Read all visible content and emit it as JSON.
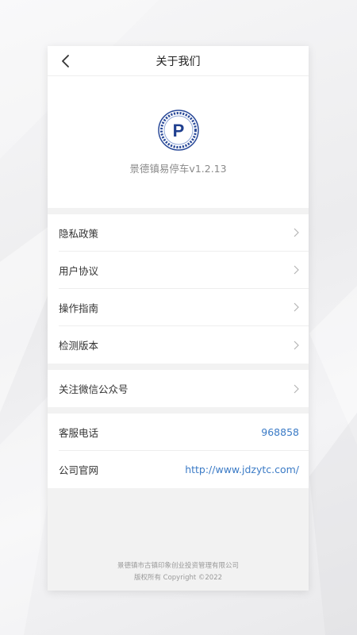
{
  "navbar": {
    "title": "关于我们"
  },
  "header": {
    "app_name": "景德镇易停车v1.2.13",
    "logo_letter": "P",
    "logo_color": "#1f3f8f"
  },
  "menu_group_1": [
    {
      "label": "隐私政策"
    },
    {
      "label": "用户协议"
    },
    {
      "label": "操作指南"
    },
    {
      "label": "检测版本"
    }
  ],
  "menu_group_2": [
    {
      "label": "关注微信公众号"
    }
  ],
  "contact_group": [
    {
      "label": "客服电话",
      "value": "968858"
    },
    {
      "label": "公司官网",
      "value": "http://www.jdzytc.com/"
    }
  ],
  "footer": {
    "company": "景德镇市古镇印象创业投资管理有限公司",
    "copyright": "版权所有 Copyright ©2022"
  },
  "colors": {
    "link": "#3b7bc6",
    "accent_logo": "#1f3f8f"
  }
}
